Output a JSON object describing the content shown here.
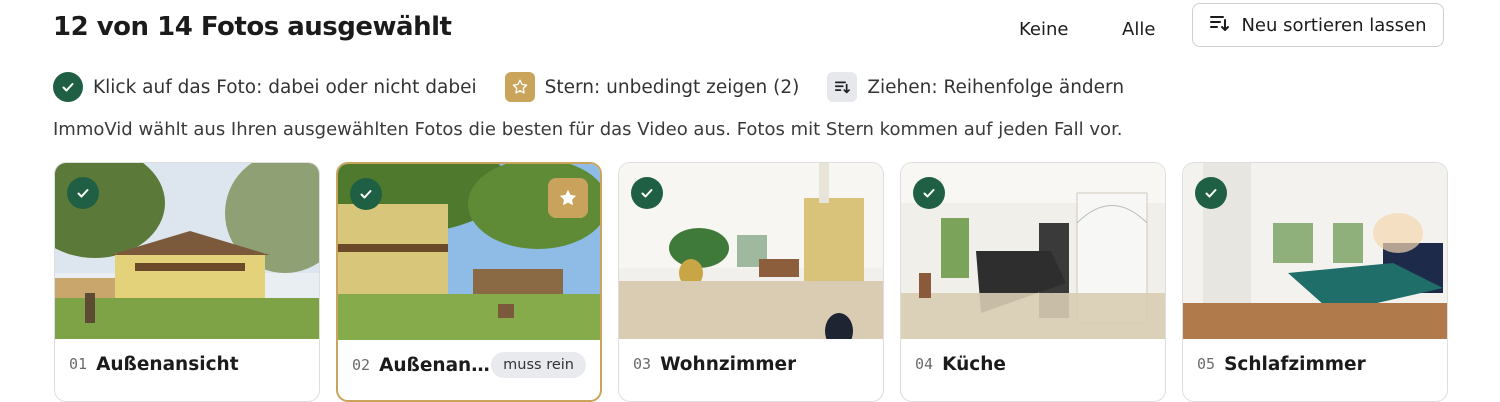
{
  "header": {
    "title": "12 von 14 Fotos ausgewählt",
    "none_label": "Keine",
    "all_label": "Alle",
    "sort_label": "Neu sortieren lassen"
  },
  "legend": {
    "select": "Klick auf das Foto: dabei oder nicht dabei",
    "star": "Stern: unbedingt zeigen (2)",
    "drag": "Ziehen: Reihenfolge ändern"
  },
  "info": "ImmoVid wählt aus Ihren ausgewählten Fotos die besten für das Video aus. Fotos mit Stern kommen auf jeden Fall vor.",
  "photos": [
    {
      "num": "01",
      "name": "Außenansicht",
      "selected": true,
      "starred": false
    },
    {
      "num": "02",
      "name": "Außenans…",
      "selected": true,
      "starred": true,
      "badge": "muss rein"
    },
    {
      "num": "03",
      "name": "Wohnzimmer",
      "selected": true,
      "starred": false
    },
    {
      "num": "04",
      "name": "Küche",
      "selected": true,
      "starred": false
    },
    {
      "num": "05",
      "name": "Schlafzimmer",
      "selected": true,
      "starred": false
    }
  ],
  "colors": {
    "accent_green": "#1f5f43",
    "star_gold": "#c9a35c",
    "chip_grey": "#e8eaee"
  }
}
